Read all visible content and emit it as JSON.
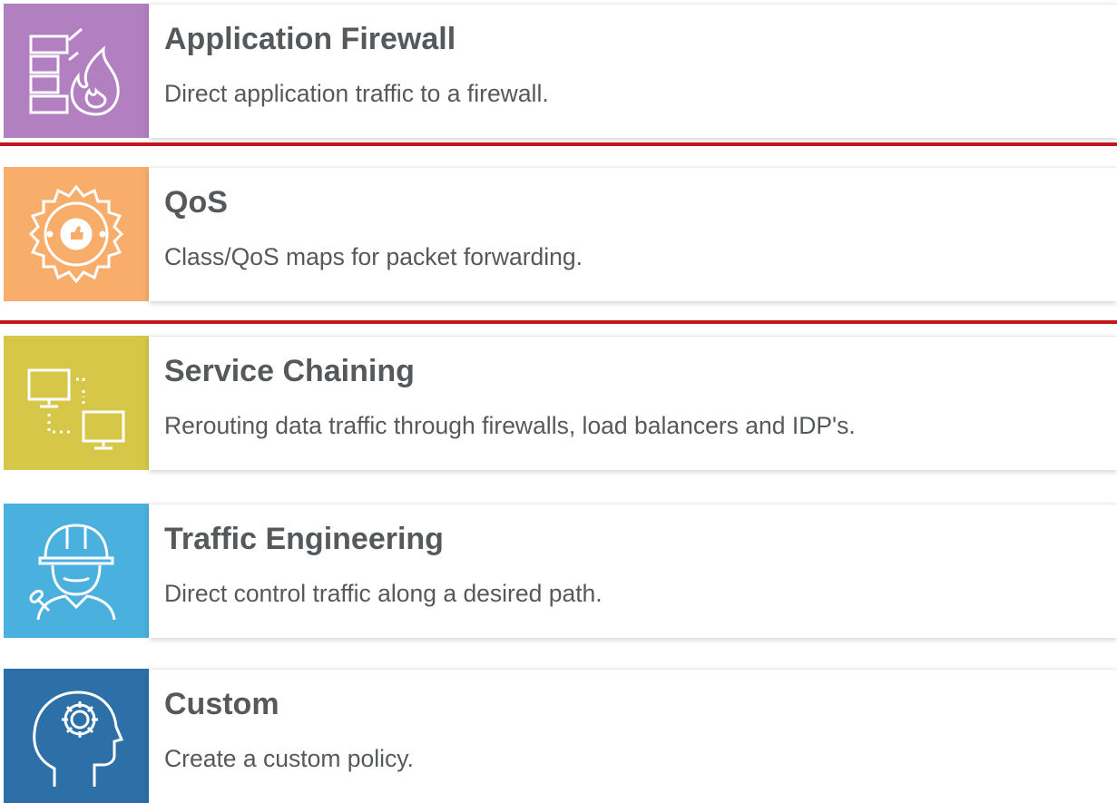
{
  "accent_divider_color": "#c3161f",
  "cards": [
    {
      "title": "Application Firewall",
      "description": "Direct application traffic to a firewall.",
      "icon": "firewall-icon",
      "color": "#b27fc0"
    },
    {
      "title": "QoS",
      "description": "Class/QoS maps for packet forwarding.",
      "icon": "qos-badge-icon",
      "color": "#f8ad6b"
    },
    {
      "title": "Service Chaining",
      "description": "Rerouting data traffic through firewalls, load balancers and IDP's.",
      "icon": "service-chaining-icon",
      "color": "#d6c749"
    },
    {
      "title": "Traffic Engineering",
      "description": "Direct control traffic along a desired path.",
      "icon": "engineer-icon",
      "color": "#4ab0de"
    },
    {
      "title": "Custom",
      "description": "Create a custom policy.",
      "icon": "custom-brain-gear-icon",
      "color": "#2c70a7"
    }
  ]
}
